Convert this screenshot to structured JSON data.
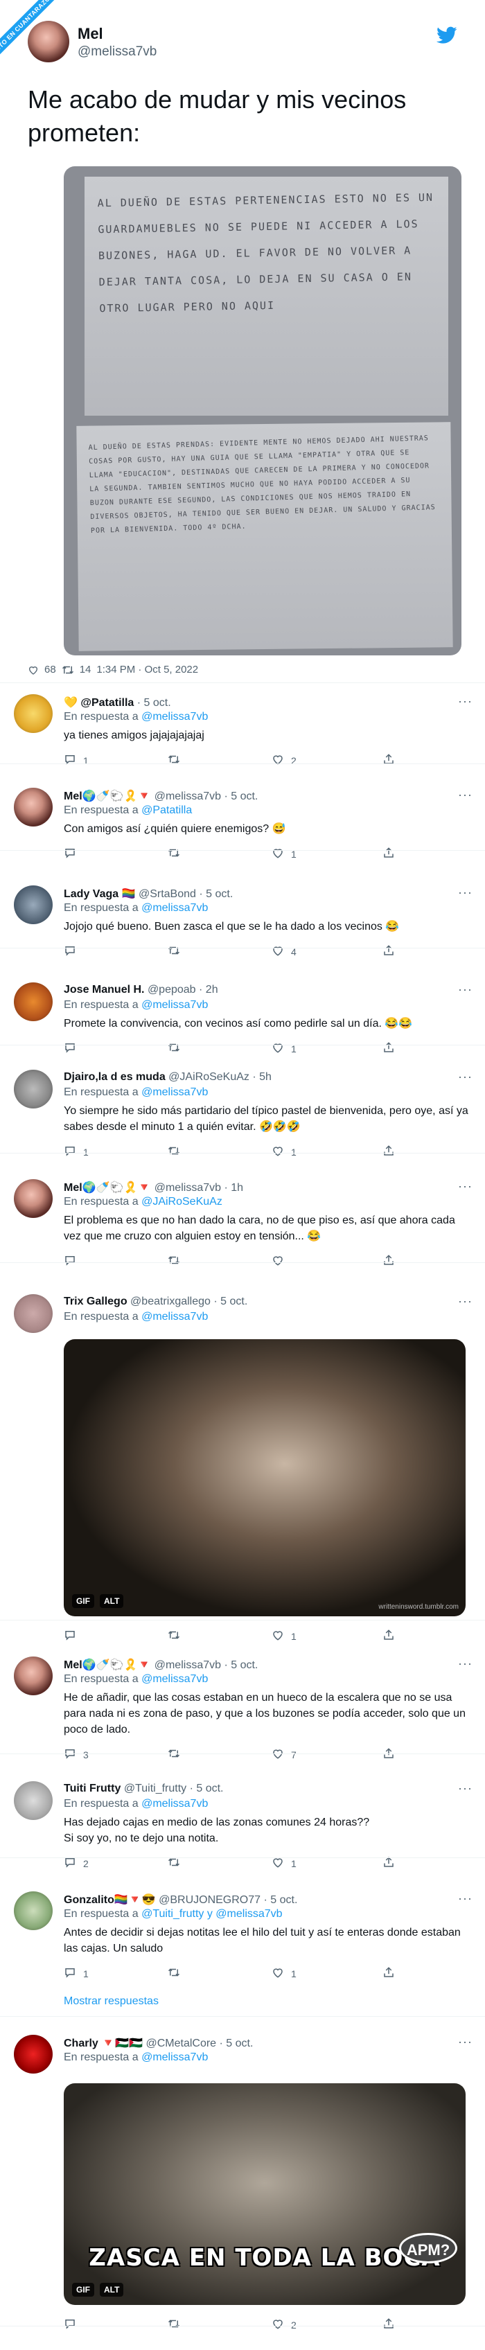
{
  "banner": "VISTO EN CUANTARAZON.COM",
  "main": {
    "name": "Mel",
    "handle": "@melissa7vb",
    "text": "Me acabo de mudar y mis vecinos prometen:",
    "note1": "AL DUEÑO DE ESTAS PERTENENCIAS ESTO NO ES UN GUARDAMUEBLES NO SE PUEDE NI ACCEDER A LOS BUZONES, HAGA UD. EL FAVOR DE NO VOLVER A DEJAR TANTA COSA, LO DEJA EN SU CASA O EN OTRO LUGAR PERO NO AQUI",
    "note2": "AL DUEÑO DE ESTAS PRENDAS: EVIDENTE MENTE NO HEMOS DEJADO AHI NUESTRAS COSAS POR GUSTO, HAY UNA GUIA QUE SE LLAMA \"EMPATIA\" Y OTRA QUE SE LLAMA \"EDUCACION\", DESTINADAS QUE CARECEN DE LA PRIMERA Y NO CONOCEDOR LA SEGUNDA. TAMBIEN SENTIMOS MUCHO QUE NO HAYA PODIDO ACCEDER A SU BUZON DURANTE ESE SEGUNDO, LAS CONDICIONES QUE NOS HEMOS TRAIDO EN DIVERSOS OBJETOS, HA TENIDO QUE SER BUENO EN DEJAR. UN SALUDO Y GRACIAS POR LA BIENVENIDA. TODO 4º DCHA.",
    "likes": "68",
    "retweets": "14",
    "time": "1:34 PM · Oct 5, 2022"
  },
  "replies": [
    {
      "name": "💛 @Patatilla",
      "handle": "· 5 oct.",
      "in_prefix": "En respuesta a",
      "in": "@melissa7vb",
      "text": "ya tienes amigos jajajajajajaj",
      "reply": "1",
      "rt": "",
      "like": "2"
    },
    {
      "name": "Mel🌍🍼🐑🎗️🔻",
      "handle": "@melissa7vb · 5 oct.",
      "in_prefix": "En respuesta a",
      "in": "@Patatilla",
      "text": "Con amigos así ¿quién quiere enemigos? 😅",
      "reply": "",
      "rt": "",
      "like": "1"
    },
    {
      "name": "Lady Vaga 🏳️‍🌈",
      "handle": "@SrtaBond · 5 oct.",
      "in_prefix": "En respuesta a",
      "in": "@melissa7vb",
      "text": "Jojojo qué bueno. Buen zasca el que se le ha dado a los vecinos 😂",
      "reply": "",
      "rt": "",
      "like": "4"
    },
    {
      "name": "Jose Manuel H.",
      "handle": "@pepoab · 2h",
      "in_prefix": "En respuesta a",
      "in": "@melissa7vb",
      "text": "Promete la convivencia, con vecinos así como pedirle sal un día. 😂😂",
      "reply": "",
      "rt": "",
      "like": "1"
    },
    {
      "name": "Djairo,la d es muda",
      "handle": "@JAiRoSeKuAz · 5h",
      "in_prefix": "En respuesta a",
      "in": "@melissa7vb",
      "text": "Yo siempre he sido más partidario del típico pastel de bienvenida, pero oye, así ya sabes desde el minuto 1 a quién evitar. 🤣🤣🤣",
      "reply": "1",
      "rt": "",
      "like": "1"
    },
    {
      "name": "Mel🌍🍼🐑🎗️🔻",
      "handle": "@melissa7vb · 1h",
      "in_prefix": "En respuesta a",
      "in": "@JAiRoSeKuAz",
      "text": "El problema es que no han dado la cara, no de que piso es, así que ahora cada vez que me cruzo con alguien estoy en tensión... 😂",
      "reply": "",
      "rt": "",
      "like": ""
    },
    {
      "name": "Trix Gallego",
      "handle": "@beatrixgallego · 5 oct.",
      "in_prefix": "En respuesta a",
      "in": "@melissa7vb",
      "text": "",
      "gif": "GIF",
      "alt": "ALT",
      "watermark": "writteninsword.tumblr.com",
      "reply": "",
      "rt": "",
      "like": "1"
    },
    {
      "name": "Mel🌍🍼🐑🎗️🔻",
      "handle": "@melissa7vb · 5 oct.",
      "in_prefix": "En respuesta a",
      "in": "@melissa7vb",
      "text": "He de añadir, que las cosas estaban en un hueco de la escalera que no se usa para nada ni es zona de paso, y que a los buzones se podía acceder, solo que un poco de lado.",
      "reply": "3",
      "rt": "",
      "like": "7"
    },
    {
      "name": "Tuiti Frutty",
      "handle": "@Tuiti_frutty · 5 oct.",
      "in_prefix": "En respuesta a",
      "in": "@melissa7vb",
      "text": "Has dejado cajas en medio de las zonas comunes 24 horas??\nSi soy yo, no te dejo una notita.",
      "reply": "2",
      "rt": "",
      "like": "1"
    },
    {
      "name": "Gonzalito🏳️‍🌈🔻😎",
      "handle": "@BRUJONEGRO77 · 5 oct.",
      "in_prefix": "En respuesta a",
      "in": "@Tuiti_frutty y @melissa7vb",
      "text": "Antes de decidir si dejas notitas lee  el hilo del tuit y así te enteras donde estaban las cajas. Un saludo",
      "reply": "1",
      "rt": "",
      "like": "1",
      "more": "Mostrar respuestas"
    },
    {
      "name": "Charly 🔻🇵🇸🇵🇸",
      "handle": "@CMetalCore · 5 oct.",
      "in_prefix": "En respuesta a",
      "in": "@melissa7vb",
      "text": "",
      "gif": "GIF",
      "alt": "ALT",
      "caption": "ZASCA EN TODA LA BOCA",
      "apm": "APM?",
      "reply": "",
      "rt": "",
      "like": "2"
    }
  ]
}
